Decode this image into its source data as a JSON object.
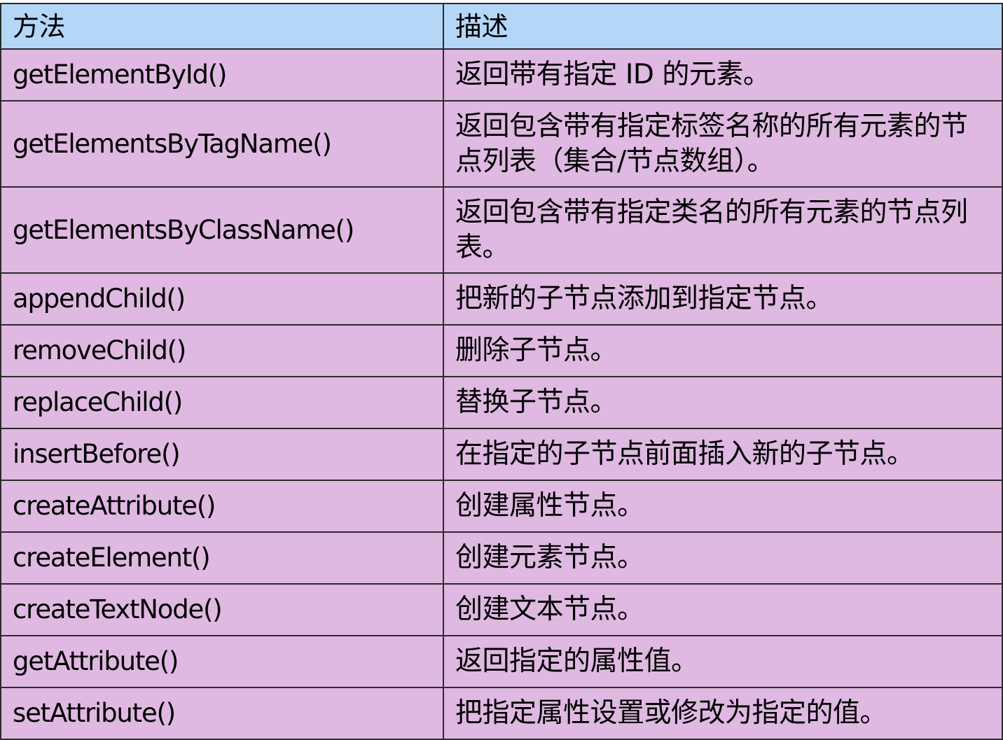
{
  "table": {
    "headers": {
      "method": "方法",
      "description": "描述"
    },
    "rows": [
      {
        "method": "getElementById()",
        "description": "返回带有指定 ID 的元素。"
      },
      {
        "method": "getElementsByTagName()",
        "description": "返回包含带有指定标签名称的所有元素的节点列表（集合/节点数组）。"
      },
      {
        "method": "getElementsByClassName()",
        "description": "返回包含带有指定类名的所有元素的节点列表。"
      },
      {
        "method": "appendChild()",
        "description": "把新的子节点添加到指定节点。"
      },
      {
        "method": "removeChild()",
        "description": "删除子节点。"
      },
      {
        "method": "replaceChild()",
        "description": "替换子节点。"
      },
      {
        "method": "insertBefore()",
        "description": "在指定的子节点前面插入新的子节点。"
      },
      {
        "method": "createAttribute()",
        "description": "创建属性节点。"
      },
      {
        "method": "createElement()",
        "description": "创建元素节点。"
      },
      {
        "method": "createTextNode()",
        "description": "创建文本节点。"
      },
      {
        "method": "getAttribute()",
        "description": "返回指定的属性值。"
      },
      {
        "method": "setAttribute()",
        "description": "把指定属性设置或修改为指定的值。"
      }
    ]
  },
  "colors": {
    "header_background": "#b4d6f7",
    "row_background": "#dfb9e1",
    "border": "#2b2b2b"
  }
}
